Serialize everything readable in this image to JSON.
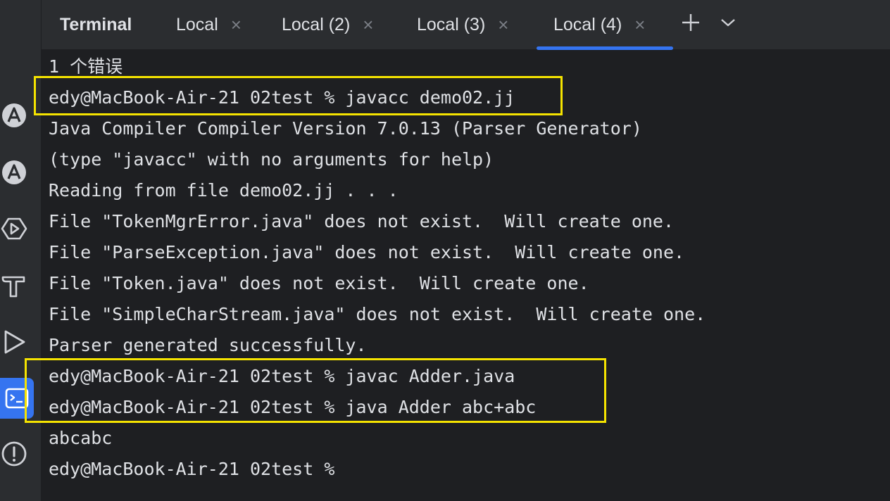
{
  "header": {
    "title": "Terminal",
    "tabs": [
      {
        "label": "Local"
      },
      {
        "label": "Local (2)"
      },
      {
        "label": "Local (3)"
      },
      {
        "label": "Local (4)",
        "active": true
      }
    ],
    "close_glyph": "×",
    "add_glyph": "+",
    "menu_glyph": "⌄"
  },
  "sidebar": {
    "tools": [
      {
        "icon": "android-icon"
      },
      {
        "icon": "android-icon"
      },
      {
        "icon": "run-widget-icon"
      },
      {
        "icon": "build-hammer-icon"
      },
      {
        "icon": "run-play-icon"
      },
      {
        "icon": "terminal-icon",
        "active": true
      },
      {
        "icon": "problems-icon"
      }
    ]
  },
  "terminal": {
    "lines": [
      "1 个错误",
      "edy@MacBook-Air-21 02test % javacc demo02.jj",
      "Java Compiler Compiler Version 7.0.13 (Parser Generator)",
      "(type \"javacc\" with no arguments for help)",
      "Reading from file demo02.jj . . .",
      "File \"TokenMgrError.java\" does not exist.  Will create one.",
      "File \"ParseException.java\" does not exist.  Will create one.",
      "File \"Token.java\" does not exist.  Will create one.",
      "File \"SimpleCharStream.java\" does not exist.  Will create one.",
      "Parser generated successfully.",
      "edy@MacBook-Air-21 02test % javac Adder.java",
      "edy@MacBook-Air-21 02test % java Adder abc+abc",
      "abcabc",
      "edy@MacBook-Air-21 02test %"
    ]
  },
  "colors": {
    "background": "#1e1f22",
    "panel": "#2b2d30",
    "accent": "#3574f0",
    "highlight": "#f5e300",
    "text": "#dfe1e5"
  }
}
